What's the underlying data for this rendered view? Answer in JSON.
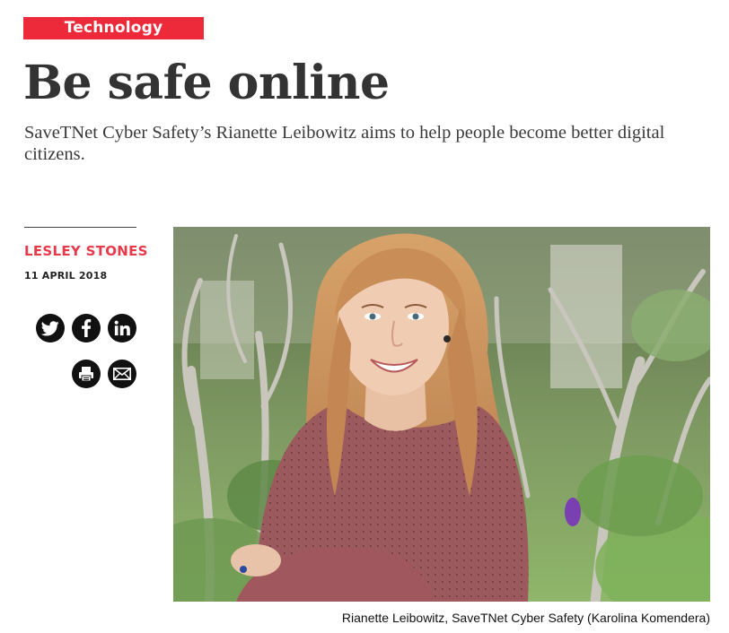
{
  "article": {
    "category": "Technology",
    "headline": "Be safe online",
    "standfirst": "SaveTNet Cyber Safety’s Rianette Leibowitz aims to help people become better digital citizens.",
    "author": "LESLEY STONES",
    "date": "11 APRIL 2018"
  },
  "share": {
    "buttons": [
      {
        "name": "twitter",
        "icon": "twitter-icon"
      },
      {
        "name": "facebook",
        "icon": "facebook-icon"
      },
      {
        "name": "linkedin",
        "icon": "linkedin-icon"
      },
      {
        "name": "print",
        "icon": "print-icon"
      },
      {
        "name": "email",
        "icon": "mail-icon"
      }
    ]
  },
  "image": {
    "caption": "Rianette Leibowitz, SaveTNet Cyber Safety (Karolina Komendera)"
  },
  "colors": {
    "accent": "#ec2a3a",
    "author": "#e8394a",
    "headline": "#333333",
    "icon_bg": "#111111"
  }
}
